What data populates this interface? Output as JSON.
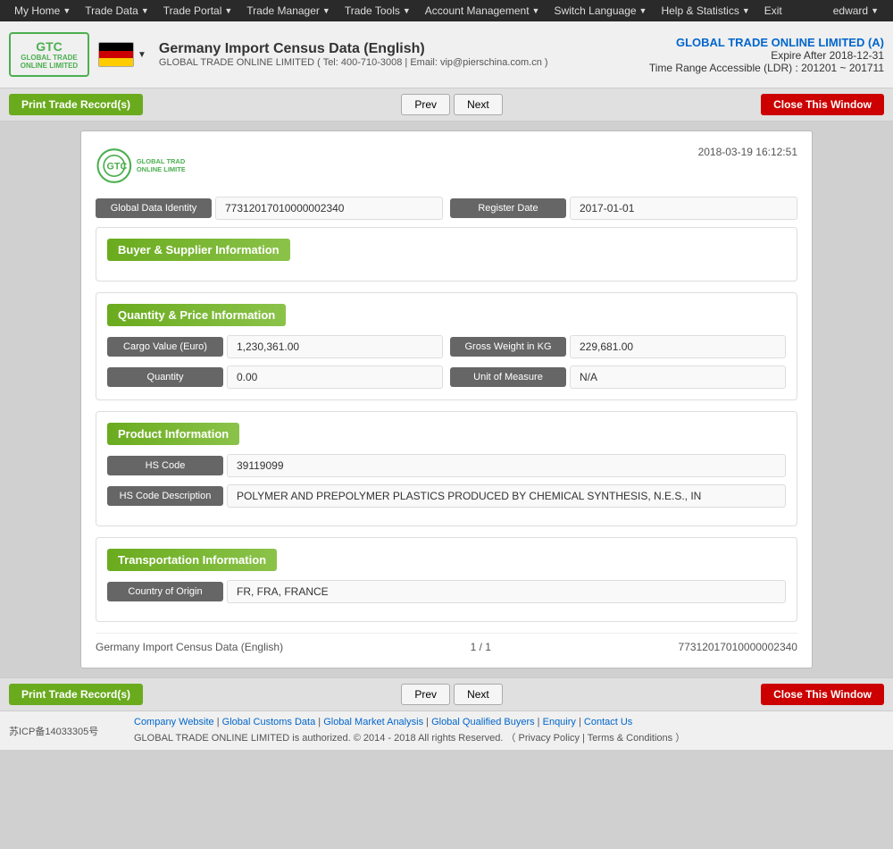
{
  "topnav": {
    "items": [
      {
        "label": "My Home",
        "arrow": true
      },
      {
        "label": "Trade Data",
        "arrow": true
      },
      {
        "label": "Trade Portal",
        "arrow": true
      },
      {
        "label": "Trade Manager",
        "arrow": true
      },
      {
        "label": "Trade Tools",
        "arrow": true
      },
      {
        "label": "Account Management",
        "arrow": true
      },
      {
        "label": "Switch Language",
        "arrow": true
      },
      {
        "label": "Help & Statistics",
        "arrow": true
      },
      {
        "label": "Exit",
        "arrow": false
      }
    ],
    "user": "edward"
  },
  "header": {
    "title": "Germany Import Census Data (English)",
    "subtitle": "GLOBAL TRADE ONLINE LIMITED ( Tel: 400-710-3008  |  Email: vip@pierschina.com.cn  )",
    "company": "GLOBAL TRADE ONLINE LIMITED (A)",
    "expire": "Expire After 2018-12-31",
    "time_range": "Time Range Accessible (LDR) : 201201 ~ 201711"
  },
  "toolbar": {
    "print_label": "Print Trade Record(s)",
    "prev_label": "Prev",
    "next_label": "Next",
    "close_label": "Close This Window"
  },
  "record": {
    "timestamp": "2018-03-19 16:12:51",
    "global_data_identity_label": "Global Data Identity",
    "global_data_identity_value": "77312017010000002340",
    "register_date_label": "Register Date",
    "register_date_value": "2017-01-01",
    "buyer_supplier_section": "Buyer & Supplier Information",
    "qty_price_section": "Quantity & Price Information",
    "cargo_value_label": "Cargo Value (Euro)",
    "cargo_value": "1,230,361.00",
    "gross_weight_label": "Gross Weight in KG",
    "gross_weight": "229,681.00",
    "quantity_label": "Quantity",
    "quantity_value": "0.00",
    "unit_of_measure_label": "Unit of Measure",
    "unit_of_measure_value": "N/A",
    "product_section": "Product Information",
    "hs_code_label": "HS Code",
    "hs_code_value": "39119099",
    "hs_desc_label": "HS Code Description",
    "hs_desc_value": "POLYMER AND PREPOLYMER PLASTICS PRODUCED BY CHEMICAL SYNTHESIS, N.E.S., IN",
    "transport_section": "Transportation Information",
    "country_origin_label": "Country of Origin",
    "country_origin_value": "FR, FRA, FRANCE",
    "footer_title": "Germany Import Census Data (English)",
    "footer_page": "1 / 1",
    "footer_id": "77312017010000002340"
  },
  "site_footer": {
    "icp": "苏ICP备14033305号",
    "links": [
      "Company Website",
      "Global Customs Data",
      "Global Market Analysis",
      "Global Qualified Buyers",
      "Enquiry",
      "Contact Us"
    ],
    "copyright": "GLOBAL TRADE ONLINE LIMITED is authorized. © 2014 - 2018 All rights Reserved.  （ Privacy Policy | Terms & Conditions ）"
  }
}
